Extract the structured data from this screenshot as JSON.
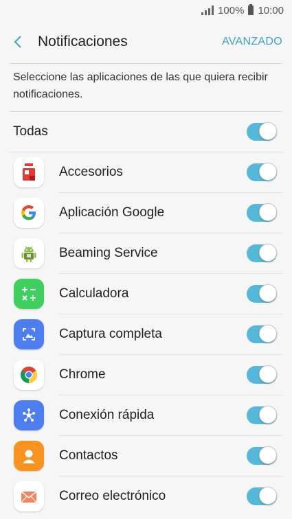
{
  "status_bar": {
    "signal": "signal-icon",
    "battery_text": "100%",
    "time": "10:00"
  },
  "header": {
    "title": "Notificaciones",
    "action": "AVANZADO"
  },
  "description": "Seleccione las aplicaciones de las que quiera recibir notificaciones.",
  "all": {
    "label": "Todas",
    "enabled": true
  },
  "apps": [
    {
      "name": "Accesorios",
      "icon": "accessories-icon",
      "enabled": true
    },
    {
      "name": "Aplicación Google",
      "icon": "google-icon",
      "enabled": true
    },
    {
      "name": "Beaming Service",
      "icon": "android-icon",
      "enabled": true
    },
    {
      "name": "Calculadora",
      "icon": "calculator-icon",
      "enabled": true
    },
    {
      "name": "Captura completa",
      "icon": "screenshot-icon",
      "enabled": true
    },
    {
      "name": "Chrome",
      "icon": "chrome-icon",
      "enabled": true
    },
    {
      "name": "Conexión rápida",
      "icon": "quick-connect-icon",
      "enabled": true
    },
    {
      "name": "Contactos",
      "icon": "contacts-icon",
      "enabled": true
    },
    {
      "name": "Correo electrónico",
      "icon": "email-icon",
      "enabled": true
    }
  ],
  "colors": {
    "accent": "#3aa2c9",
    "toggle_on": "#55b8d9"
  }
}
